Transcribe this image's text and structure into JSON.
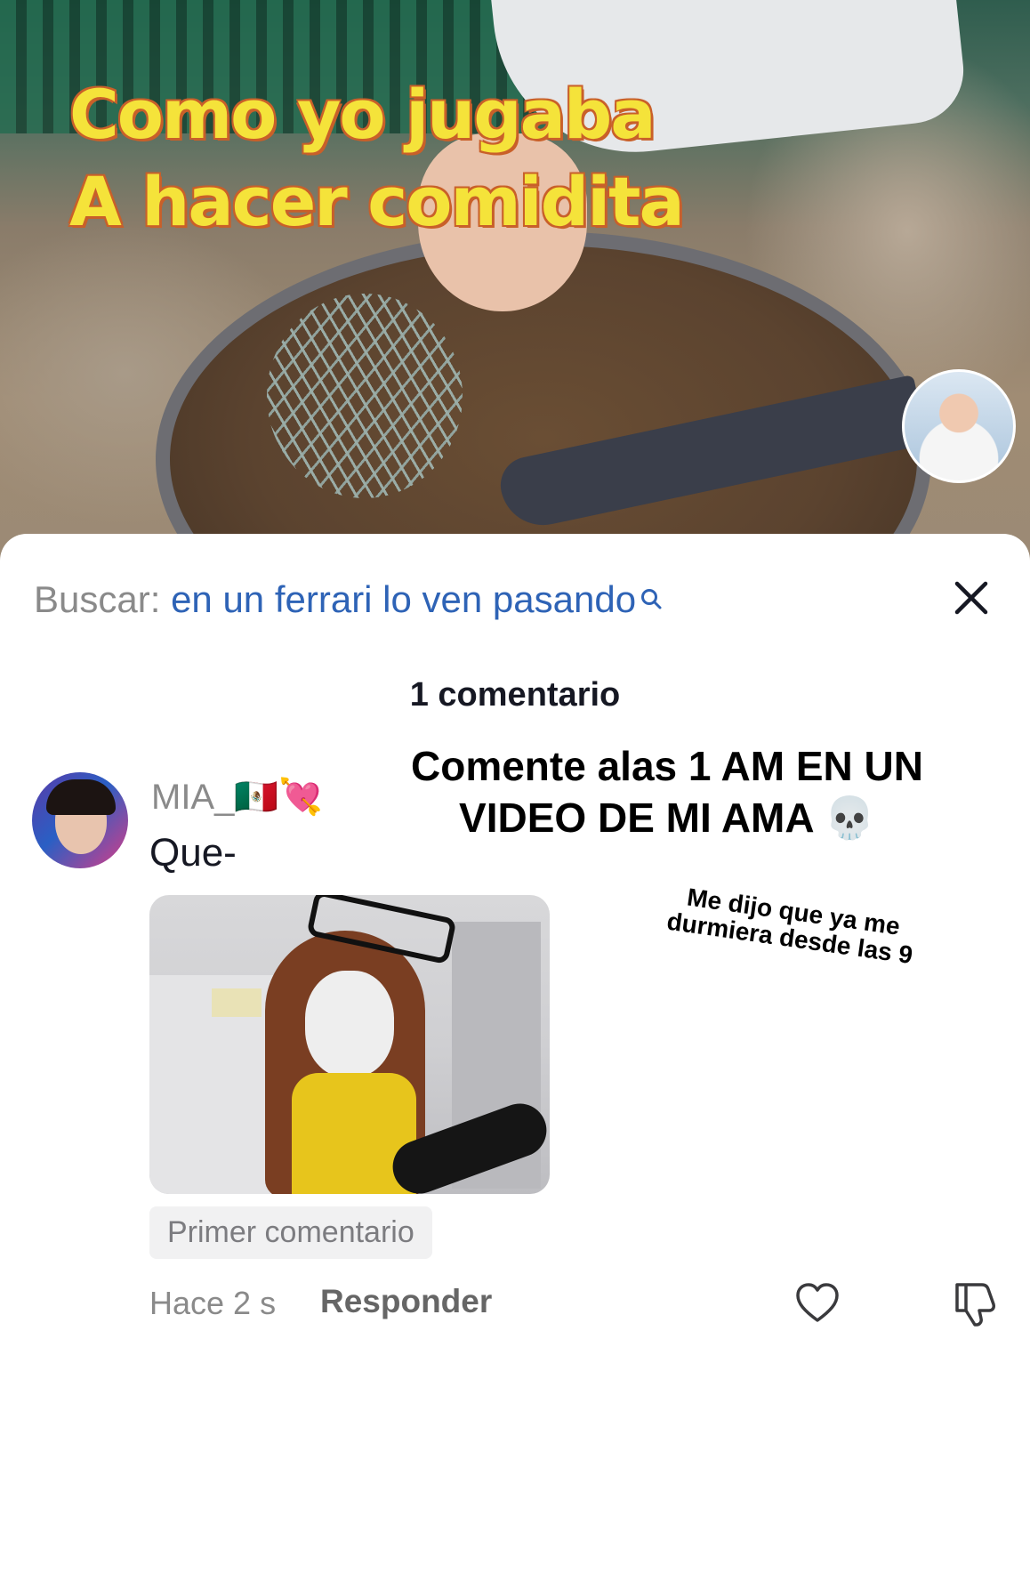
{
  "video": {
    "overlay_line1": "Como yo jugaba",
    "overlay_line2": "A hacer comidita",
    "creator_avatar_icon": "avatar-icon"
  },
  "search": {
    "label": "Buscar:",
    "term": "en un ferrari lo ven pasando",
    "icon": "search-icon",
    "term_color": "#2e63b6"
  },
  "close_icon": "close-icon",
  "comments": {
    "count_label": "1 comentario",
    "items": [
      {
        "username": "MIA_🇲🇽💘",
        "text": "Que-",
        "badge": "Primer comentario",
        "time": "Hace 2 s",
        "reply_label": "Responder"
      }
    ]
  },
  "overlay_captions": {
    "big": "Comente alas 1 AM EN UN VIDEO DE MI AMA 💀",
    "small": "Me dijo que ya me durmiera desde las 9"
  },
  "icons": {
    "like": "heart-icon",
    "dislike": "thumbs-down-icon"
  }
}
